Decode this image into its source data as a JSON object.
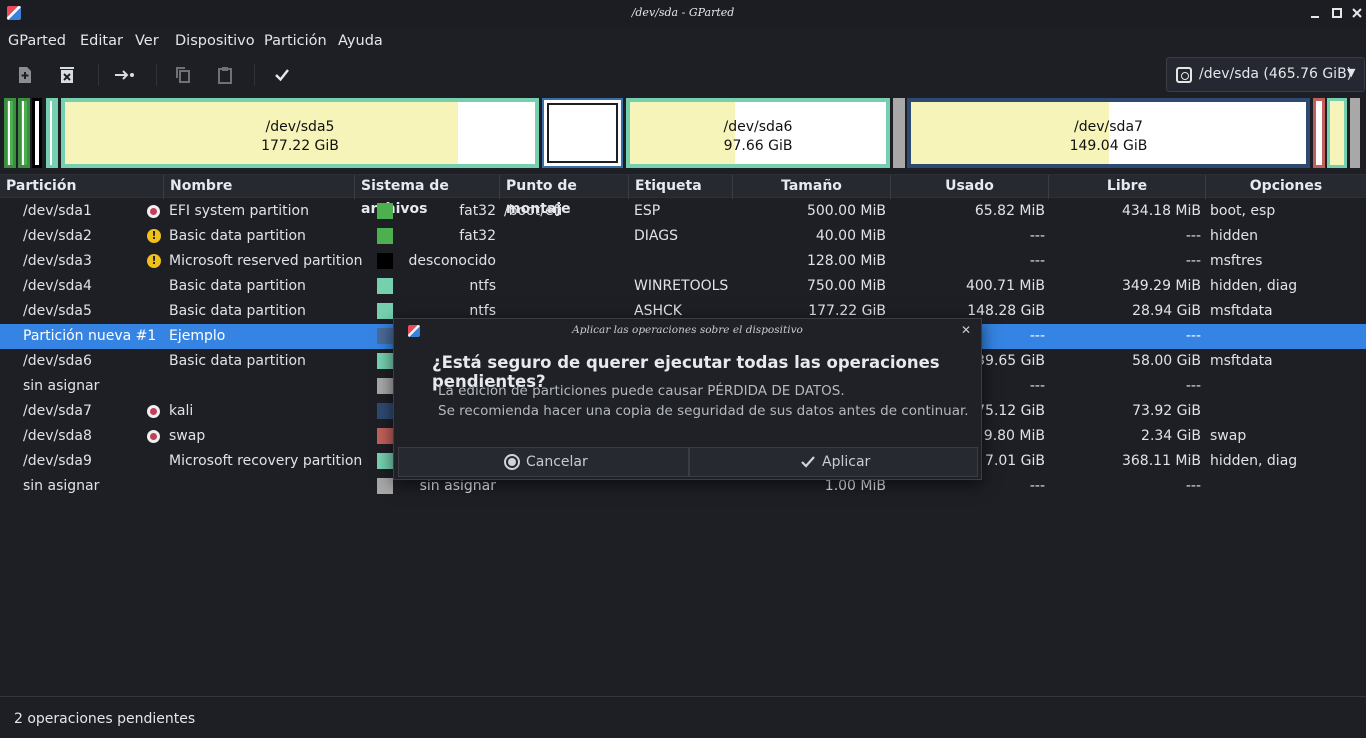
{
  "window": {
    "title": "/dev/sda - GParted"
  },
  "menu": [
    "GParted",
    "Editar",
    "Ver",
    "Dispositivo",
    "Partición",
    "Ayuda"
  ],
  "toolbar": {
    "icons": [
      "new-partition-icon",
      "delete-partition-icon",
      "resize-move-icon",
      "copy-icon",
      "paste-icon",
      "apply-icon"
    ]
  },
  "device": {
    "label": "/dev/sda (465.76 GiB)"
  },
  "diskmap": {
    "sda5": {
      "name": "/dev/sda5",
      "size": "177.22 GiB"
    },
    "sda6": {
      "name": "/dev/sda6",
      "size": "97.66 GiB"
    },
    "sda7": {
      "name": "/dev/sda7",
      "size": "149.04 GiB"
    }
  },
  "columns": [
    "Partición",
    "Nombre",
    "Sistema de archivos",
    "Punto de montaje",
    "Etiqueta",
    "Tamaño",
    "Usado",
    "Libre",
    "Opciones"
  ],
  "rows": [
    {
      "partition": "/dev/sda1",
      "status": "lock",
      "name": "EFI system partition",
      "fs_color": "#4caf50",
      "fs": "fat32",
      "mount": "/boot/efi",
      "label": "ESP",
      "size": "500.00 MiB",
      "used": "65.82 MiB",
      "free": "434.18 MiB",
      "flags": "boot, esp"
    },
    {
      "partition": "/dev/sda2",
      "status": "warn",
      "name": "Basic data partition",
      "fs_color": "#4caf50",
      "fs": "fat32",
      "mount": "",
      "label": "DIAGS",
      "size": "40.00 MiB",
      "used": "---",
      "free": "---",
      "flags": "hidden"
    },
    {
      "partition": "/dev/sda3",
      "status": "warn",
      "name": "Microsoft reserved partition",
      "fs_color": "#000000",
      "fs": "desconocido",
      "mount": "",
      "label": "",
      "size": "128.00 MiB",
      "used": "---",
      "free": "---",
      "flags": "msftres"
    },
    {
      "partition": "/dev/sda4",
      "status": "",
      "name": "Basic data partition",
      "fs_color": "#76d0b0",
      "fs": "ntfs",
      "mount": "",
      "label": "WINRETOOLS",
      "size": "750.00 MiB",
      "used": "400.71 MiB",
      "free": "349.29 MiB",
      "flags": "hidden, diag"
    },
    {
      "partition": "/dev/sda5",
      "status": "",
      "name": "Basic data partition",
      "fs_color": "#76d0b0",
      "fs": "ntfs",
      "mount": "",
      "label": "ASHCK",
      "size": "177.22 GiB",
      "used": "148.28 GiB",
      "free": "28.94 GiB",
      "flags": "msftdata"
    },
    {
      "partition": "Partición nueva #1",
      "status": "",
      "name": "Ejemplo",
      "fs_color": "#4a6a9a",
      "fs": "",
      "mount": "",
      "label": "",
      "size": "",
      "used": "---",
      "free": "---",
      "flags": "",
      "selected": true
    },
    {
      "partition": "/dev/sda6",
      "status": "",
      "name": "Basic data partition",
      "fs_color": "#76d0b0",
      "fs": "",
      "mount": "",
      "label": "",
      "size": "",
      "used": "39.65 GiB",
      "free": "58.00 GiB",
      "flags": "msftdata"
    },
    {
      "partition": "sin asignar",
      "status": "",
      "name": "",
      "fs_color": "#a8a8a8",
      "fs": "",
      "mount": "",
      "label": "",
      "size": "",
      "used": "---",
      "free": "---",
      "flags": ""
    },
    {
      "partition": "/dev/sda7",
      "status": "lock",
      "name": "kali",
      "fs_color": "#2f4a70",
      "fs": "",
      "mount": "",
      "label": "",
      "size": "",
      "used": "75.12 GiB",
      "free": "73.92 GiB",
      "flags": ""
    },
    {
      "partition": "/dev/sda8",
      "status": "lock",
      "name": "swap",
      "fs_color": "#c0605a",
      "fs": "",
      "mount": "",
      "label": "",
      "size": "",
      "used": "9.80 MiB",
      "free": "2.34 GiB",
      "flags": "swap"
    },
    {
      "partition": "/dev/sda9",
      "status": "",
      "name": "Microsoft recovery partition",
      "fs_color": "#76d0b0",
      "fs": "",
      "mount": "",
      "label": "",
      "size": "",
      "used": "7.01 GiB",
      "free": "368.11 MiB",
      "flags": "hidden, diag"
    },
    {
      "partition": "sin asignar",
      "status": "",
      "name": "",
      "fs_color": "#a8a8a8",
      "fs": "sin asignar",
      "mount": "",
      "label": "",
      "size": "1.00 MiB",
      "used": "---",
      "free": "---",
      "flags": ""
    }
  ],
  "status": {
    "text": "2 operaciones pendientes"
  },
  "dialog": {
    "title": "Aplicar las operaciones sobre el dispositivo",
    "heading": "¿Está seguro de querer ejecutar todas las operaciones pendientes?",
    "message_line1": "La edición de particiones puede causar PÉRDIDA DE DATOS.",
    "message_line2": "Se recomienda hacer una copia de seguridad de sus datos antes de continuar.",
    "cancel": "Cancelar",
    "apply": "Aplicar"
  }
}
